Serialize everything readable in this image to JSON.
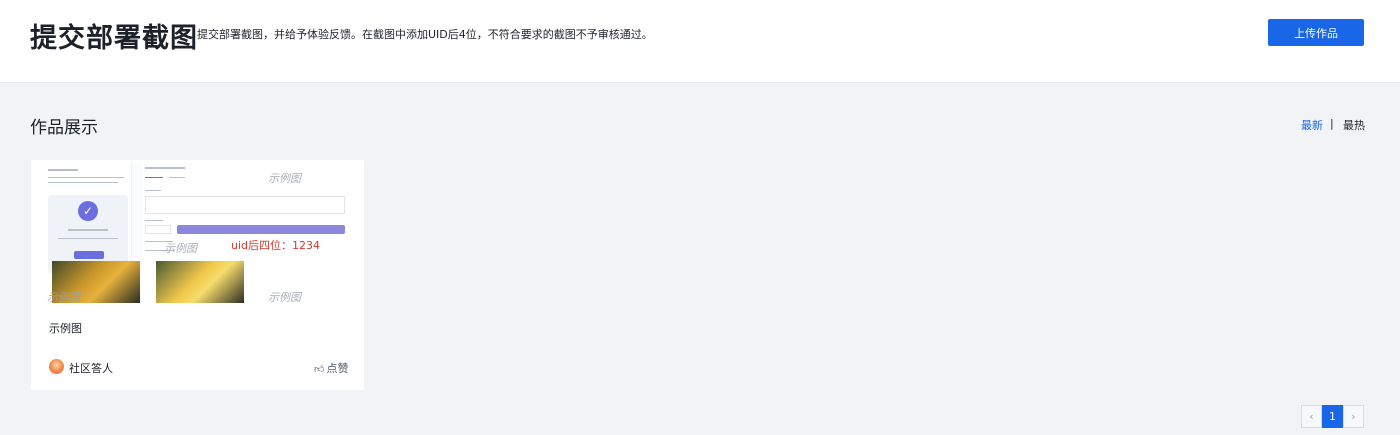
{
  "header": {
    "title": "提交部署截图",
    "description": "提交部署截图，并给予体验反馈。在截图中添加UID后4位，不符合要求的截图不予审核通过。",
    "upload_label": "上传作品"
  },
  "gallery": {
    "title": "作品展示",
    "sort_newest": "最新",
    "sort_separator": "|",
    "sort_hottest": "最热"
  },
  "card": {
    "watermark": "示例图",
    "uid_note": "uid后四位：1234",
    "title": "示例图",
    "author": "社区答人",
    "like_label": "点赞",
    "like_icon": "thumbs-up-icon"
  },
  "pagination": {
    "prev": "‹",
    "current": "1",
    "next": "›"
  },
  "colors": {
    "accent": "#1966e8",
    "uid_red": "#d13a2c",
    "background": "#f2f3f5"
  }
}
